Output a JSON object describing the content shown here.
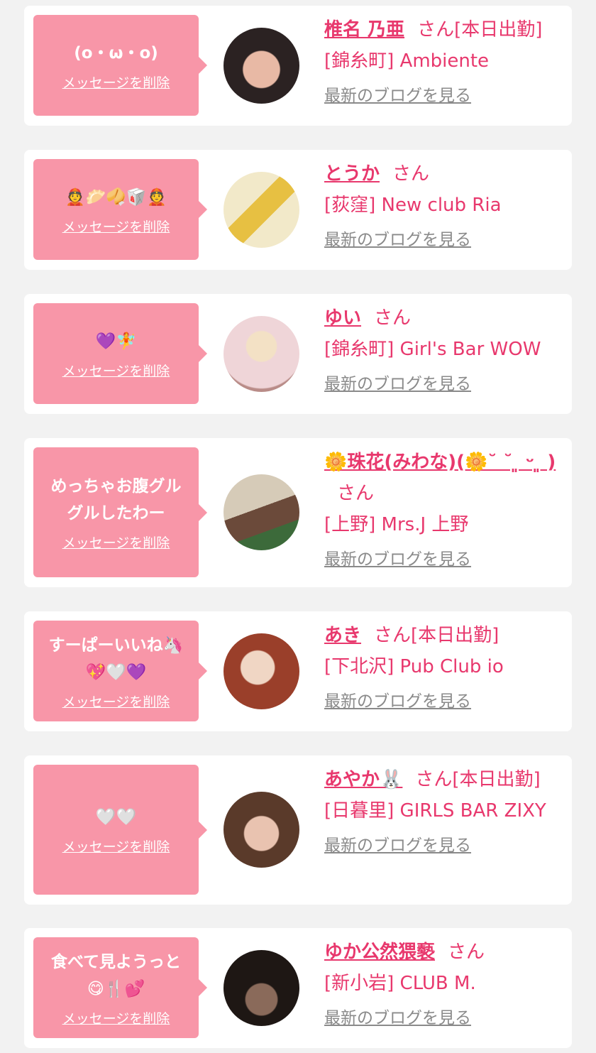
{
  "cards": [
    {
      "bubble_message": "(o・ω・o)",
      "delete_label": "メッセージを削除",
      "name": "椎名 乃亜",
      "suffix": "さん[本日出勤]",
      "shop": "[錦糸町] Ambiente",
      "blog_label": "最新のブログを見る",
      "avatar_colors": [
        "#2b2222",
        "#e8b9a5"
      ]
    },
    {
      "bubble_message": "👲🥟🥠🥡👲",
      "delete_label": "メッセージを削除",
      "name": "とうか",
      "suffix": "さん",
      "shop": "[荻窪] New club Ria",
      "blog_label": "最新のブログを見る",
      "avatar_colors": [
        "#f2e9c9",
        "#e7c042"
      ]
    },
    {
      "bubble_message": "💜🧚",
      "delete_label": "メッセージを削除",
      "name": "ゆい",
      "suffix": "さん",
      "shop": "[錦糸町] Girl's Bar WOW",
      "blog_label": "最新のブログを見る",
      "avatar_colors": [
        "#efd5d8",
        "#b98c88"
      ]
    },
    {
      "bubble_message": "めっちゃお腹グル\nグルしたわー",
      "delete_label": "メッセージを削除",
      "name": "🌼珠花(みわな)(🌼˘ ˘ ͈ ᵕ ͈ )",
      "suffix": "さん",
      "shop": "[上野] Mrs.J 上野",
      "blog_label": "最新のブログを見る",
      "avatar_colors": [
        "#d6cbb8",
        "#6b4a3a"
      ]
    },
    {
      "bubble_message": "すーぱーいいね🦄\n💖🤍💜",
      "delete_label": "メッセージを削除",
      "name": "あき",
      "suffix": "さん[本日出勤]",
      "shop": "[下北沢] Pub Club io",
      "blog_label": "最新のブログを見る",
      "avatar_colors": [
        "#9a3f2a",
        "#f0d6c4"
      ]
    },
    {
      "bubble_message": "🤍🤍",
      "delete_label": "メッセージを削除",
      "name": "あやか🐰",
      "suffix": "さん[本日出勤]",
      "shop": "[日暮里] GIRLS BAR ZIXY",
      "blog_label": "最新のブログを見る",
      "avatar_colors": [
        "#5a3a2a",
        "#e9c3b0"
      ]
    },
    {
      "bubble_message": "食べて見ようっと\n😋🍴💕",
      "delete_label": "メッセージを削除",
      "name": "ゆか公然猥褻",
      "suffix": "さん",
      "shop": "[新小岩] CLUB M.",
      "blog_label": "最新のブログを見る",
      "avatar_colors": [
        "#1e1714",
        "#8a6a5a"
      ]
    }
  ]
}
